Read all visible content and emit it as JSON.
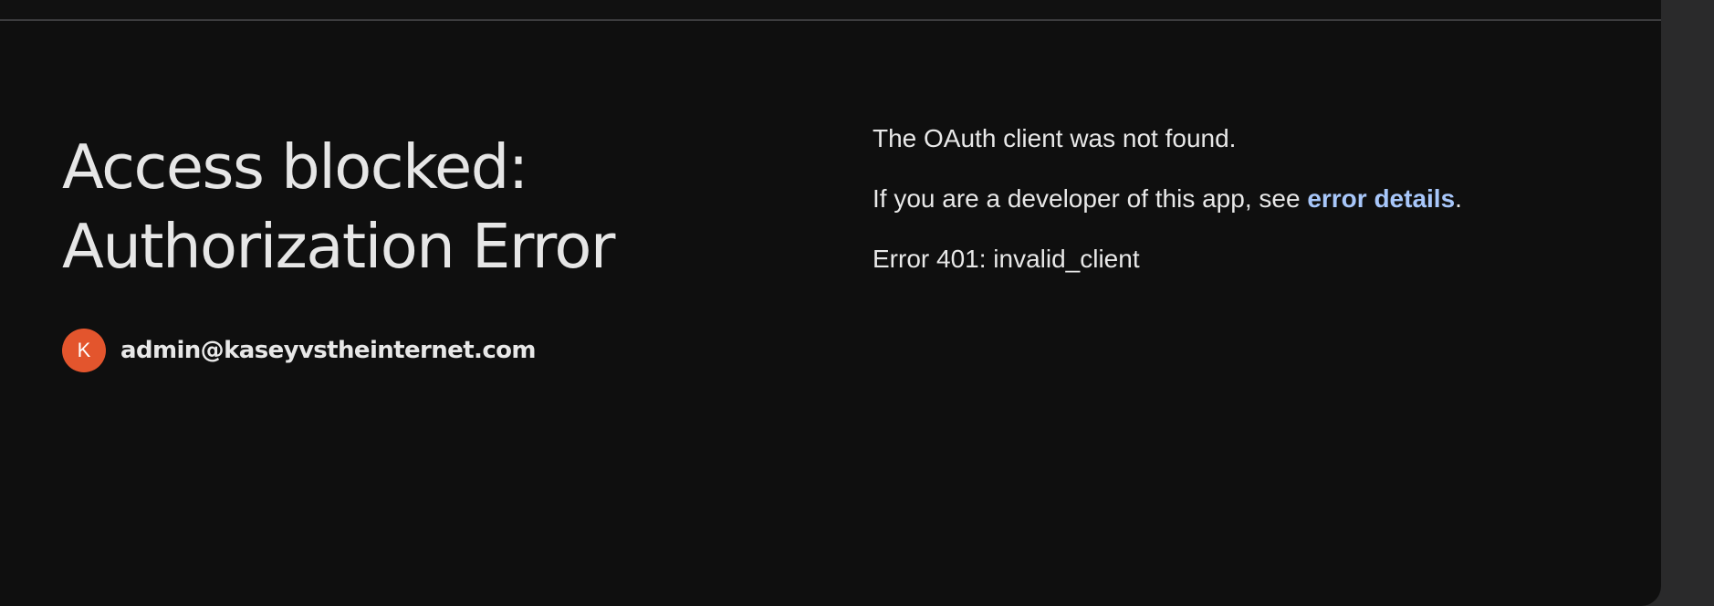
{
  "heading": {
    "line1": "Access blocked:",
    "line2": "Authorization Error"
  },
  "account": {
    "avatar_initial": "K",
    "avatar_color": "#e3552d",
    "email": "admin@kaseyvstheinternet.com"
  },
  "details": {
    "not_found": "The OAuth client was not found.",
    "developer_prefix": "If you are a developer of this app, see ",
    "developer_link": "error details",
    "developer_suffix": ".",
    "error_code": "Error 401: invalid_client"
  },
  "colors": {
    "background": "#0f0f0f",
    "link": "#a8c7fa",
    "text": "#e8e8e8"
  }
}
